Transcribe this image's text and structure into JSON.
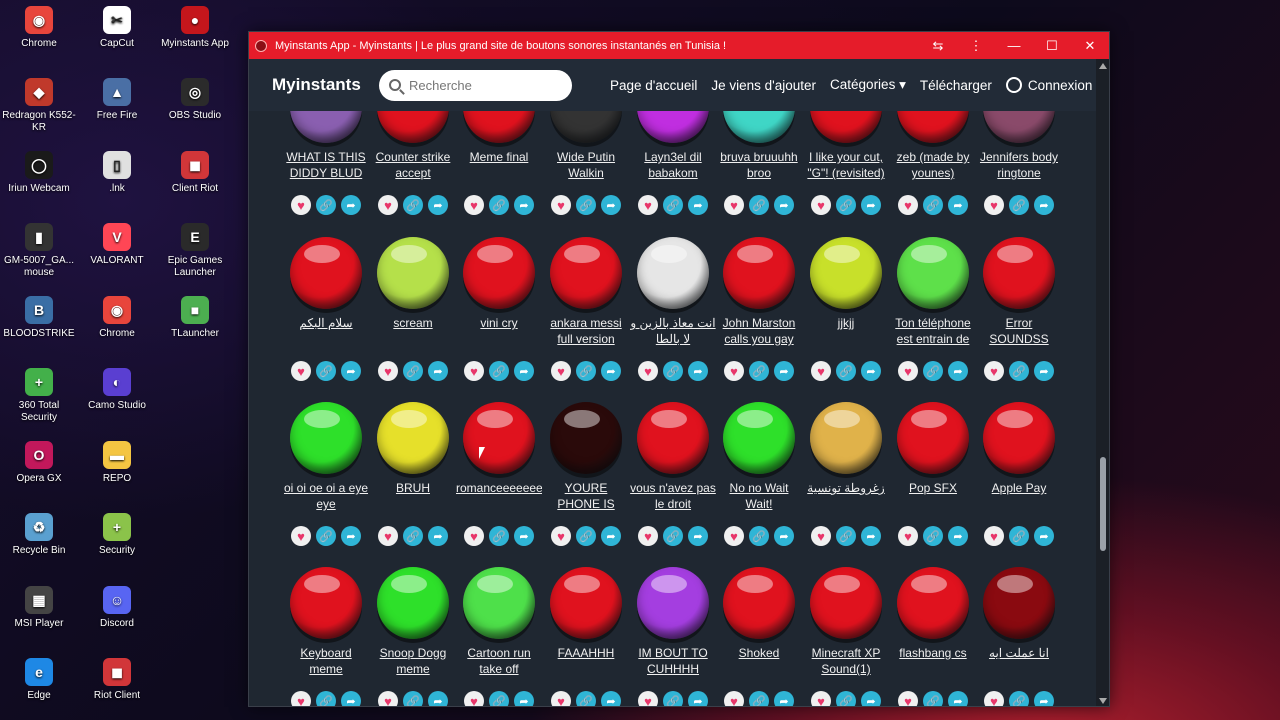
{
  "desktop": [
    {
      "label": "Chrome",
      "icon": "chrome-icon",
      "color": "#e8453c",
      "g": "◉"
    },
    {
      "label": "CapCut",
      "icon": "capcut-icon",
      "color": "#ffffff",
      "g": "✂"
    },
    {
      "label": "Myinstants App",
      "icon": "myinstants-icon",
      "color": "#c4161c",
      "g": "●"
    },
    {
      "label": "Redragon K552-KR",
      "icon": "redragon-icon",
      "color": "#c0392b",
      "g": "◆"
    },
    {
      "label": "Free Fire",
      "icon": "freefire-icon",
      "color": "#4a6fa5",
      "g": "▲"
    },
    {
      "label": "OBS Studio",
      "icon": "obs-icon",
      "color": "#2b2b2b",
      "g": "◎"
    },
    {
      "label": "Iriun Webcam",
      "icon": "webcam-icon",
      "color": "#1a1a1a",
      "g": "◯"
    },
    {
      "label": ".lnk",
      "icon": "file-icon",
      "color": "#e0e0e0",
      "g": "▯"
    },
    {
      "label": "Client Riot",
      "icon": "riot-icon",
      "color": "#d13639",
      "g": "◼"
    },
    {
      "label": "GM-5007_GA... mouse",
      "icon": "mouse-icon",
      "color": "#333333",
      "g": "▮"
    },
    {
      "label": "VALORANT",
      "icon": "valorant-icon",
      "color": "#ff4655",
      "g": "V"
    },
    {
      "label": "Epic Games Launcher",
      "icon": "epic-icon",
      "color": "#2a2a2a",
      "g": "E"
    },
    {
      "label": "BLOODSTRIKE",
      "icon": "bloodstrike-icon",
      "color": "#3a6ea5",
      "g": "B"
    },
    {
      "label": "Chrome",
      "icon": "chrome-icon",
      "color": "#e8453c",
      "g": "◉"
    },
    {
      "label": "TLauncher",
      "icon": "tlauncher-icon",
      "color": "#4caf50",
      "g": "■"
    },
    {
      "label": "360 Total Security",
      "icon": "security360-icon",
      "color": "#43b04a",
      "g": "+"
    },
    {
      "label": "Camo Studio",
      "icon": "camo-icon",
      "color": "#5a3fd1",
      "g": "◐"
    },
    {
      "label": "Opera GX",
      "icon": "operagx-icon",
      "color": "#c2185b",
      "g": "O"
    },
    {
      "label": "REPO",
      "icon": "folder-icon",
      "color": "#f4c542",
      "g": "▬"
    },
    {
      "label": "Recycle Bin",
      "icon": "recycle-bin-icon",
      "color": "#5aa0d0",
      "g": "♻"
    },
    {
      "label": "Security",
      "icon": "security-icon",
      "color": "#8bc34a",
      "g": "+"
    },
    {
      "label": "MSI Player",
      "icon": "msi-icon",
      "color": "#444444",
      "g": "▦"
    },
    {
      "label": "Discord",
      "icon": "discord-icon",
      "color": "#5865f2",
      "g": "☺"
    },
    {
      "label": "Edge",
      "icon": "edge-icon",
      "color": "#1e88e5",
      "g": "e"
    },
    {
      "label": "Riot Client",
      "icon": "riot-icon",
      "color": "#d13639",
      "g": "◼"
    }
  ],
  "window": {
    "title": "Myinstants App - Myinstants | Le plus grand site de boutons sonores instantanés en Tunisia !",
    "controls": {
      "translate": "⇆",
      "menu": "⋮",
      "minimize": "—",
      "maximize": "☐",
      "close": "✕"
    }
  },
  "navbar": {
    "brand": "Myinstants",
    "search_placeholder": "Recherche",
    "links": {
      "home": "Page d'accueil",
      "just_added": "Je viens d'ajouter",
      "categories": "Catégories ▾",
      "download": "Télécharger",
      "login": "Connexion"
    }
  },
  "sounds": [
    [
      {
        "label": "WHAT IS THIS DIDDY BLUD",
        "color": "#8a5fb0"
      },
      {
        "label": "Counter strike accept",
        "color": "#e0121e"
      },
      {
        "label": "Meme final",
        "color": "#e0121e"
      },
      {
        "label": "Wide Putin Walkin",
        "color": "#333333"
      },
      {
        "label": "Layn3el dil babakom",
        "color": "#c02ee0"
      },
      {
        "label": "bruva bruuuhh broo",
        "color": "#3fd6c6"
      },
      {
        "label": "I like your cut, \"G\"! (revisited)",
        "color": "#e0121e"
      },
      {
        "label": "zeb (made by younes)",
        "color": "#e0121e"
      },
      {
        "label": "Jennifers body ringtone",
        "color": "#8a4a6a"
      }
    ],
    [
      {
        "label": "سلام البكم",
        "color": "#e0121e"
      },
      {
        "label": "scream",
        "color": "#b5e04a"
      },
      {
        "label": "vini cry",
        "color": "#e0121e"
      },
      {
        "label": "ankara messi full version",
        "color": "#e0121e"
      },
      {
        "label": "انت معاذ بالزين و لا بالطا",
        "color": "#e6e6e6"
      },
      {
        "label": "John Marston calls you gay",
        "color": "#e0121e"
      },
      {
        "label": "jjkjj",
        "color": "#c8e02a"
      },
      {
        "label": "Ton téléphone est entrain de",
        "color": "#5ee04a"
      },
      {
        "label": "Error SOUNDSS",
        "color": "#e0121e"
      }
    ],
    [
      {
        "label": "oi oi oe oi a eye eye",
        "color": "#2ee02a"
      },
      {
        "label": "BRUH",
        "color": "#e6e02a"
      },
      {
        "label": "romanceeeeeeeeeeeeee",
        "color": "#e0121e"
      },
      {
        "label": "YOURE PHONE IS RINGING",
        "color": "#2a0a0a"
      },
      {
        "label": "vous n'avez pas le droit",
        "color": "#e0121e"
      },
      {
        "label": "No no Wait Wait!",
        "color": "#2ee02a"
      },
      {
        "label": "زغروطة تونسية",
        "color": "#e0b24a"
      },
      {
        "label": "Pop SFX",
        "color": "#e0121e"
      },
      {
        "label": "Apple Pay",
        "color": "#e0121e"
      }
    ],
    [
      {
        "label": "Keyboard meme",
        "color": "#e0121e"
      },
      {
        "label": "Snoop Dogg meme",
        "color": "#2ee02a"
      },
      {
        "label": "Cartoon run take off",
        "color": "#4ee04a"
      },
      {
        "label": "FAAAHHH",
        "color": "#e0121e"
      },
      {
        "label": "IM BOUT TO CUHHHH",
        "color": "#a43ee0"
      },
      {
        "label": "Shoked",
        "color": "#e0121e"
      },
      {
        "label": "Minecraft XP Sound(1)",
        "color": "#e0121e"
      },
      {
        "label": "flashbang cs",
        "color": "#e0121e"
      },
      {
        "label": "انا عملت ايه",
        "color": "#8a0a10"
      }
    ]
  ],
  "action_icons": {
    "favorite": "♥",
    "copy_link": "🔗",
    "share": "➦"
  }
}
